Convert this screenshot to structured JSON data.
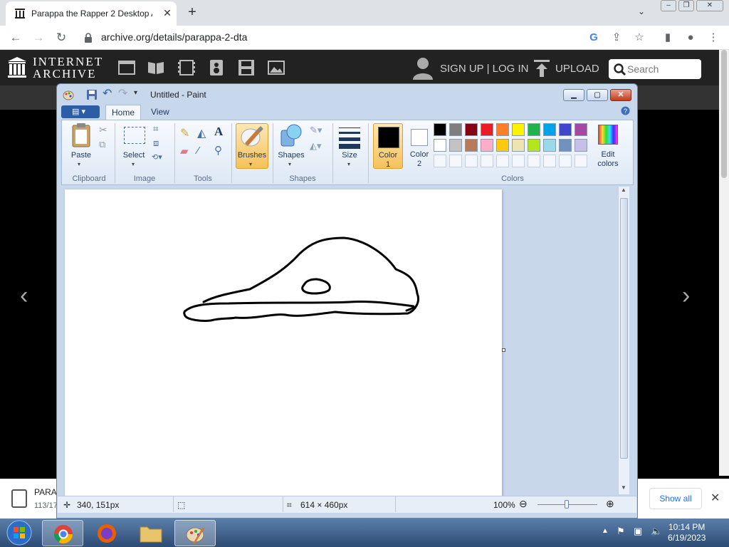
{
  "browser": {
    "tab_title": "Parappa the Rapper 2 Desktop A",
    "tab_close": "✕",
    "new_tab": "+",
    "tab_search": "⌄",
    "url": "archive.org/details/parappa-2-dta",
    "window_controls": [
      "–",
      "❐",
      "✕"
    ]
  },
  "ia": {
    "logo_line1": "INTERNET",
    "logo_line2": "ARCHIVE",
    "signup": "SIGN UP | LOG IN",
    "upload": "UPLOAD",
    "search_placeholder": "Search"
  },
  "download_bar": {
    "file_name": "PARA",
    "file_status": "113/17",
    "show_all": "Show all"
  },
  "paint": {
    "title": "Untitled - Paint",
    "tabs": {
      "home": "Home",
      "view": "View"
    },
    "clipboard": {
      "paste": "Paste",
      "group": "Clipboard"
    },
    "image": {
      "select": "Select",
      "group": "Image"
    },
    "tools": {
      "group": "Tools"
    },
    "brushes": "Brushes",
    "shapes": {
      "label": "Shapes",
      "group": "Shapes"
    },
    "size": "Size",
    "color1": [
      "Color",
      "1"
    ],
    "color2": [
      "Color",
      "2"
    ],
    "edit_colors": [
      "Edit",
      "colors"
    ],
    "colors_group": "Colors",
    "palette_row1": [
      "#000000",
      "#7f7f7f",
      "#880015",
      "#ed1c24",
      "#ff7f27",
      "#fff200",
      "#22b14c",
      "#00a2e8",
      "#3f48cc",
      "#a349a4"
    ],
    "palette_row2": [
      "#ffffff",
      "#c3c3c3",
      "#b97a57",
      "#ffaec9",
      "#ffc90e",
      "#efe4b0",
      "#b5e61d",
      "#99d9ea",
      "#7092be",
      "#c8bfe7"
    ],
    "status": {
      "cursor_pos": "340, 151px",
      "canvas_size": "614 × 460px",
      "zoom": "100%"
    }
  },
  "taskbar": {
    "time": "10:14 PM",
    "date": "6/19/2023"
  }
}
